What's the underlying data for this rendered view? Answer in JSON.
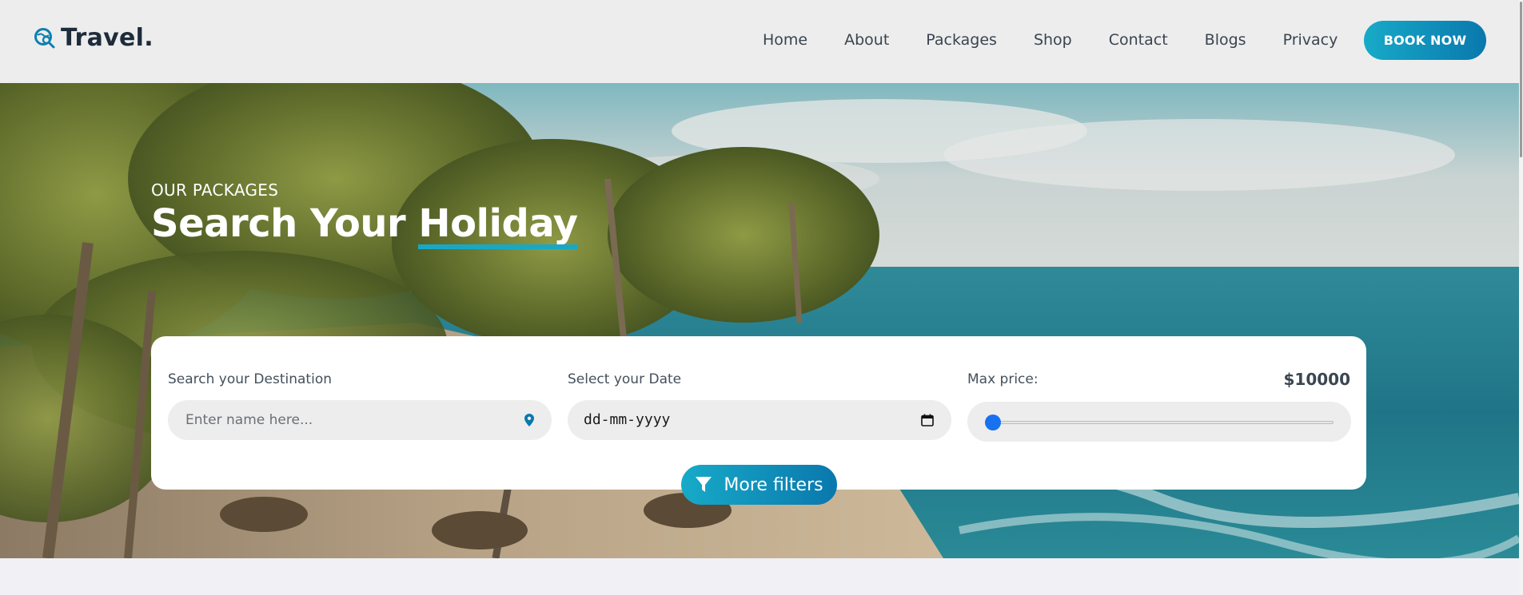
{
  "header": {
    "logo_text": "Travel.",
    "nav": [
      {
        "label": "Home"
      },
      {
        "label": "About"
      },
      {
        "label": "Packages"
      },
      {
        "label": "Shop"
      },
      {
        "label": "Contact"
      },
      {
        "label": "Blogs"
      },
      {
        "label": "Privacy"
      }
    ],
    "cta_label": "BOOK NOW"
  },
  "hero": {
    "kicker": "OUR PACKAGES",
    "title_prefix": "Search Your ",
    "title_highlight": "Holiday"
  },
  "search": {
    "destination_label": "Search your Destination",
    "destination_placeholder": "Enter name here...",
    "destination_value": "",
    "date_label": "Select your Date",
    "date_value": "dd-mm-yyyy",
    "price_label": "Max price:",
    "price_value": "$10000",
    "price_slider_fraction": 0,
    "filters_label": "More filters"
  },
  "colors": {
    "accent_start": "#17aac8",
    "accent_end": "#0a78ad",
    "slider_thumb": "#1872f0",
    "heading_dark": "#1e2b3a"
  },
  "icons": {
    "logo": "globe-search-icon",
    "destination": "map-pin-icon",
    "date": "calendar-icon",
    "filters": "filter-funnel-icon"
  }
}
